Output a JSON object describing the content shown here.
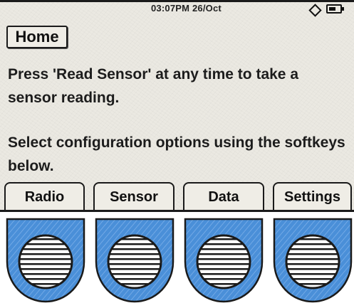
{
  "status_bar": {
    "time": "03:07PM 26/Oct",
    "signal_icon": "diamond-icon",
    "battery_icon": "battery-icon"
  },
  "screen": {
    "title": "Home",
    "message_1": "Press 'Read Sensor' at any time to take a sensor reading.",
    "message_2": "Select configuration options using the softkeys below."
  },
  "softkeys": [
    {
      "label": "Radio"
    },
    {
      "label": "Sensor"
    },
    {
      "label": "Data"
    },
    {
      "label": "Settings"
    }
  ],
  "hardware_buttons": [
    {
      "icon": "speaker-grille-icon"
    },
    {
      "icon": "speaker-grille-icon"
    },
    {
      "icon": "speaker-grille-icon"
    },
    {
      "icon": "speaker-grille-icon"
    }
  ],
  "colors": {
    "screen_background": "#ebe9e2",
    "button_fill": "#4a8fd8",
    "outline": "#1a1a1a"
  }
}
